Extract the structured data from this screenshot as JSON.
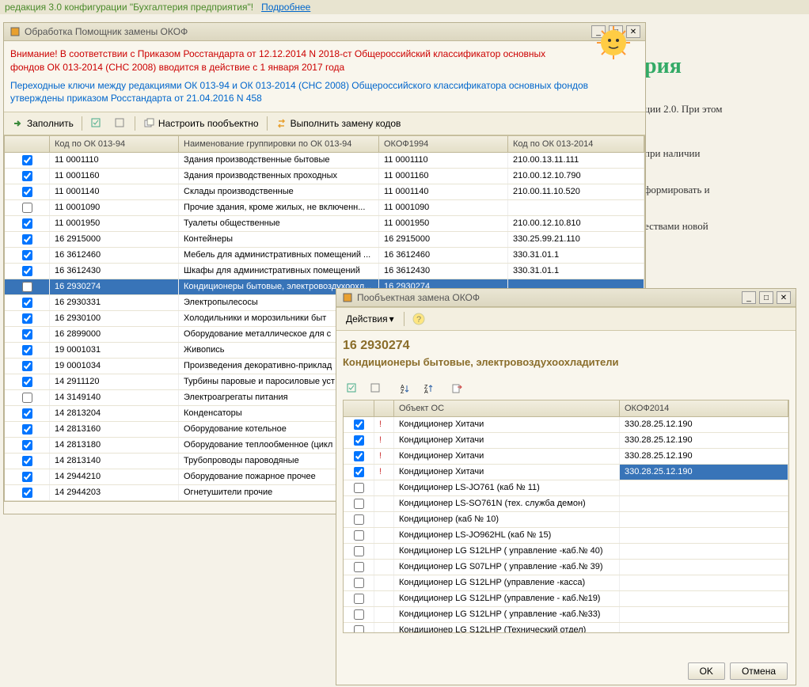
{
  "topbar": {
    "text": "редакция 3.0 конфигурации \"Бухгалтерия предприятия\"!",
    "link": "Подробнее"
  },
  "win1": {
    "title": "Обработка  Помощник замены ОКОФ",
    "notice_red": "Внимание! В соответствии с Приказом Росстандарта от 12.12.2014 N 2018-ст  Общероссийский классификатор основных фондов ОК 013-2014 (СНС 2008) вводится в действие с 1 января 2017 года",
    "notice_blue": "Переходные ключи между редакциями ОК 013-94 и ОК 013-2014 (СНС 2008) Общероссийского классификатора основных фондов утверждены приказом Росстандарта от 21.04.2016 N 458",
    "toolbar": {
      "fill": "Заполнить",
      "settings": "Настроить пообъектно",
      "replace": "Выполнить замену кодов"
    },
    "headers": {
      "code": "Код по ОК 013-94",
      "name": "Наименование группировки по ОК 013-94",
      "okof": "ОКОФ1994",
      "newcode": "Код по ОК 013-2014"
    },
    "rows": [
      {
        "chk": true,
        "code": "11 0001110",
        "name": "Здания производственные бытовые",
        "okof": "11 0001110",
        "new": "210.00.13.11.111"
      },
      {
        "chk": true,
        "code": "11 0001160",
        "name": "Здания производственных проходных",
        "okof": "11 0001160",
        "new": "210.00.12.10.790"
      },
      {
        "chk": true,
        "code": "11 0001140",
        "name": "Склады производственные",
        "okof": "11 0001140",
        "new": "210.00.11.10.520"
      },
      {
        "chk": false,
        "code": "11 0001090",
        "name": "Прочие здания, кроме жилых, не включенн...",
        "okof": "11 0001090",
        "new": ""
      },
      {
        "chk": true,
        "code": "11 0001950",
        "name": "Туалеты общественные",
        "okof": "11 0001950",
        "new": "210.00.12.10.810"
      },
      {
        "chk": true,
        "code": "16 2915000",
        "name": "Контейнеры",
        "okof": "16 2915000",
        "new": "330.25.99.21.110"
      },
      {
        "chk": true,
        "code": "16 3612460",
        "name": "Мебель для административных помещений ...",
        "okof": "16 3612460",
        "new": "330.31.01.1"
      },
      {
        "chk": true,
        "code": "16 3612430",
        "name": "Шкафы для административных помещений",
        "okof": "16 3612430",
        "new": "330.31.01.1"
      },
      {
        "chk": false,
        "code": "16 2930274",
        "name": "Кондиционеры бытовые, электровоздухоохл...",
        "okof": "16 2930274",
        "new": "",
        "sel": true
      },
      {
        "chk": true,
        "code": "16 2930331",
        "name": "Электропылесосы",
        "okof": "",
        "new": ""
      },
      {
        "chk": true,
        "code": "16 2930100",
        "name": "Холодильники и морозильники быт",
        "okof": "",
        "new": ""
      },
      {
        "chk": true,
        "code": "16 2899000",
        "name": "Оборудование металлическое для с",
        "okof": "",
        "new": ""
      },
      {
        "chk": true,
        "code": "19 0001031",
        "name": "Живопись",
        "okof": "",
        "new": ""
      },
      {
        "chk": true,
        "code": "19 0001034",
        "name": "Произведения декоративно-приклад",
        "okof": "",
        "new": ""
      },
      {
        "chk": true,
        "code": "14 2911120",
        "name": "Турбины паровые и паросиловые уст",
        "okof": "",
        "new": ""
      },
      {
        "chk": false,
        "code": "14 3149140",
        "name": "Электроагрегаты питания",
        "okof": "",
        "new": ""
      },
      {
        "chk": true,
        "code": "14 2813204",
        "name": "Конденсаторы",
        "okof": "",
        "new": ""
      },
      {
        "chk": true,
        "code": "14 2813160",
        "name": "Оборудование котельное",
        "okof": "",
        "new": ""
      },
      {
        "chk": true,
        "code": "14 2813180",
        "name": "Оборудование теплообменное (цикл",
        "okof": "",
        "new": ""
      },
      {
        "chk": true,
        "code": "14 2813140",
        "name": "Трубопроводы пароводяные",
        "okof": "",
        "new": ""
      },
      {
        "chk": true,
        "code": "14 2944210",
        "name": "Оборудование пожарное прочее",
        "okof": "",
        "new": ""
      },
      {
        "chk": true,
        "code": "14 2944203",
        "name": "Огнетушители прочие",
        "okof": "",
        "new": ""
      }
    ]
  },
  "win2": {
    "title": "Пообъектная замена ОКОФ",
    "actions": "Действия",
    "code": "16 2930274",
    "desc": "Кондиционеры бытовые, электровоздухоохладители",
    "headers": {
      "obj": "Объект ОС",
      "okof": "ОКОФ2014"
    },
    "rows": [
      {
        "chk": true,
        "mark": true,
        "obj": "Кондиционер Хитачи",
        "okof": "330.28.25.12.190"
      },
      {
        "chk": true,
        "mark": true,
        "obj": "Кондиционер Хитачи",
        "okof": "330.28.25.12.190"
      },
      {
        "chk": true,
        "mark": true,
        "obj": "Кондиционер Хитачи",
        "okof": "330.28.25.12.190"
      },
      {
        "chk": true,
        "mark": true,
        "obj": "Кондиционер Хитачи",
        "okof": "330.28.25.12.190",
        "sel": true
      },
      {
        "chk": false,
        "mark": false,
        "obj": "Кондиционер LS-JO761 (каб № 11)",
        "okof": ""
      },
      {
        "chk": false,
        "mark": false,
        "obj": "Кондиционер LS-SO761N (тех. служба демон)",
        "okof": ""
      },
      {
        "chk": false,
        "mark": false,
        "obj": "Кондиционер (каб № 10)",
        "okof": ""
      },
      {
        "chk": false,
        "mark": false,
        "obj": "Кондиционер LS-JO962HL (каб № 15)",
        "okof": ""
      },
      {
        "chk": false,
        "mark": false,
        "obj": "Кондиционер LG S12LHP ( управление -каб.№ 40)",
        "okof": ""
      },
      {
        "chk": false,
        "mark": false,
        "obj": "Кондиционер LG S07LHP ( управление -каб.№ 39)",
        "okof": ""
      },
      {
        "chk": false,
        "mark": false,
        "obj": "Кондиционер LG S12LHP (управление -касса)",
        "okof": ""
      },
      {
        "chk": false,
        "mark": false,
        "obj": "Кондиционер LG S12LHP (управление - каб.№19)",
        "okof": ""
      },
      {
        "chk": false,
        "mark": false,
        "obj": "Кондиционер LG S12LHP ( управление -каб.№33)",
        "okof": ""
      },
      {
        "chk": false,
        "mark": false,
        "obj": "Кондиционер LG S12LHP (Технический отдел)",
        "okof": ""
      }
    ],
    "ok": "OK",
    "cancel": "Отмена"
  },
  "bg": {
    "h1": "рия",
    "p1": "ции 2.0. При этом",
    "p2": "при наличии",
    "p3": "формировать и",
    "p4": "ествами новой"
  }
}
